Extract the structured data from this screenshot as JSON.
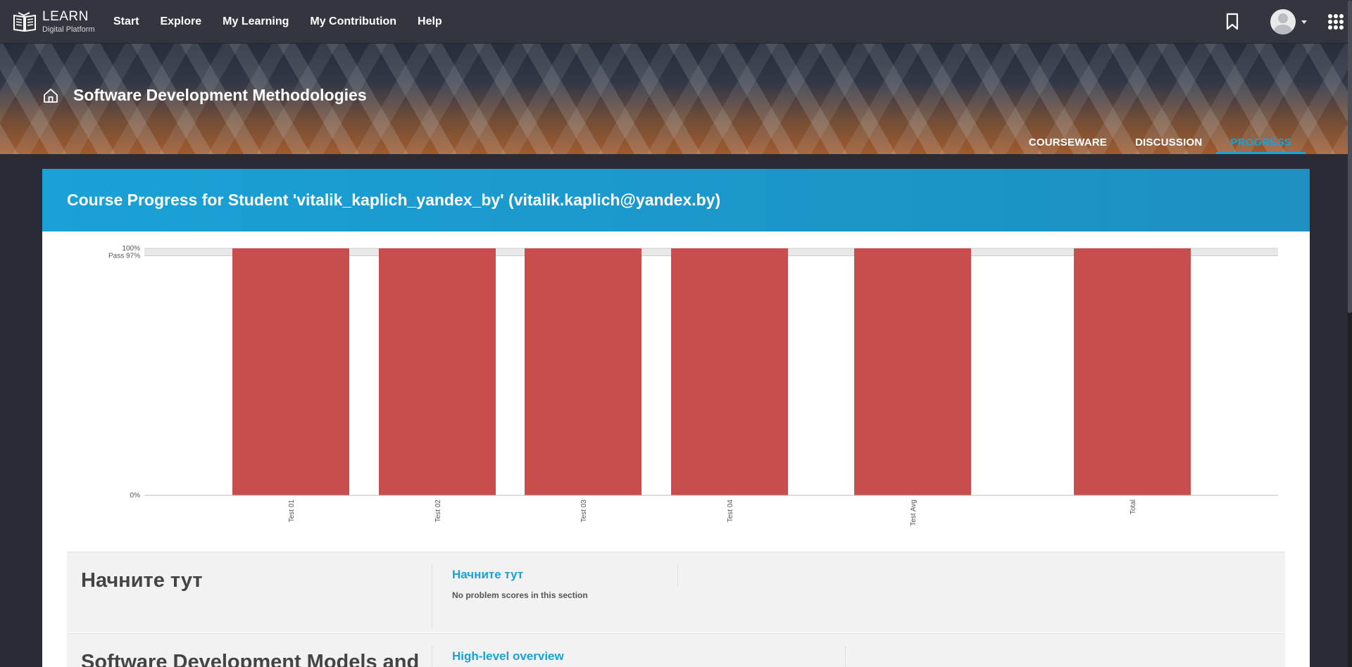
{
  "brand": {
    "title": "LEARN",
    "subtitle": "Digital Platform"
  },
  "nav": {
    "items": [
      "Start",
      "Explore",
      "My Learning",
      "My Contribution",
      "Help"
    ]
  },
  "course": {
    "title": "Software Development Methodologies",
    "tabs": [
      {
        "label": "COURSEWARE",
        "active": false
      },
      {
        "label": "DISCUSSION",
        "active": false
      },
      {
        "label": "PROGRESS",
        "active": true
      }
    ]
  },
  "progress": {
    "heading": "Course Progress for Student 'vitalik_kaplich_yandex_by' (vitalik.kaplich@yandex.by)"
  },
  "chart_data": {
    "type": "bar",
    "categories": [
      "Test 01",
      "Test 02",
      "Test 03",
      "Test 04",
      "Test Avg",
      "Total"
    ],
    "values": [
      100,
      100,
      100,
      100,
      100,
      100
    ],
    "y_tick_labels": [
      "0%",
      "Pass 97%",
      "100%"
    ],
    "y_ticks": [
      0,
      97,
      100
    ],
    "ylim": [
      0,
      100
    ],
    "bar_color": "#c84d4d",
    "grid": true
  },
  "sections": [
    {
      "title": "Начните тут",
      "subsections": [
        {
          "label": "Начните тут",
          "note": "No problem scores in this section"
        }
      ]
    },
    {
      "title": "Software Development Models and",
      "subsections": [
        {
          "label": "High-level overview"
        }
      ]
    }
  ],
  "colors": {
    "accent": "#1aa1d6",
    "navbar": "#33363f",
    "bar": "#c84d4d"
  }
}
